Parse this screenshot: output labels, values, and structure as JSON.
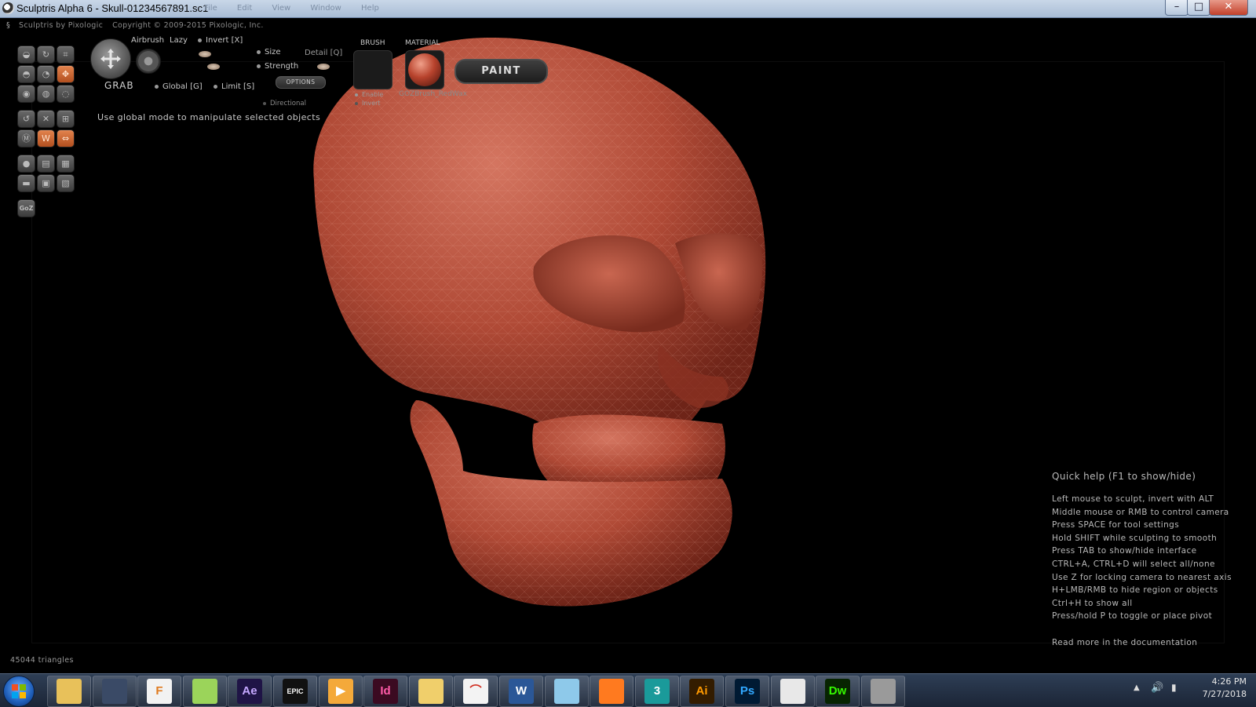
{
  "window": {
    "title": "Sculptris Alpha 6 - Skull-01234567891.sc1",
    "menu": [
      "File",
      "Edit",
      "View",
      "Window",
      "Help"
    ],
    "controls": {
      "minimize": "–",
      "maximize": "□",
      "close": "✕"
    }
  },
  "app": {
    "product": "Sculptris by Pixologic",
    "copyright": "Copyright © 2009-2015 Pixologic, Inc."
  },
  "tool_palette": {
    "goz_label": "GoZ"
  },
  "toolbar": {
    "tool_name": "GRAB",
    "airbrush_label": "Airbrush",
    "lazy_label": "Lazy",
    "invert_label": "Invert [X]",
    "size_label": "Size",
    "strength_label": "Strength",
    "detail_label": "Detail [Q]",
    "global_label": "Global [G]",
    "limit_label": "Limit [S]",
    "options_label": "OPTIONS",
    "directional_label": "Directional",
    "hint": "Use global mode to manipulate selected objects"
  },
  "brush": {
    "header": "BRUSH",
    "enable_label": "Enable",
    "invert_label": "Invert"
  },
  "material": {
    "header": "MATERIAL",
    "name": "GOZBrush_RedWax",
    "color": "#b8432d"
  },
  "paint_button": "PAINT",
  "quick_help": {
    "title": "Quick help (F1 to show/hide)",
    "lines": [
      "Left mouse to sculpt, invert with ALT",
      "Middle mouse or RMB to control camera",
      "Press SPACE for tool settings",
      "Hold SHIFT while sculpting to smooth",
      "Press TAB to show/hide interface",
      "CTRL+A, CTRL+D will select all/none",
      "Use Z for locking camera to nearest axis",
      "H+LMB/RMB to hide region or objects",
      "Ctrl+H to show all",
      "Press/hold P to toggle or place pivot"
    ],
    "more": "Read more in the documentation"
  },
  "status": {
    "triangles": "45044 triangles"
  },
  "taskbar": {
    "apps": [
      {
        "name": "Windows Explorer",
        "icon": "folder-icon",
        "text": "",
        "bg": "#e8c15a",
        "fg": "#6b4a08"
      },
      {
        "name": "3D Viewer",
        "icon": "cube-icon",
        "text": "",
        "bg": "#3a4a66",
        "fg": "#cfe3ff"
      },
      {
        "name": "Fusion",
        "icon": "f-icon",
        "text": "F",
        "bg": "#f2f2f2",
        "fg": "#e07a1f"
      },
      {
        "name": "Sticky Notes",
        "icon": "notes-icon",
        "text": "",
        "bg": "#9bd45a",
        "fg": "#333"
      },
      {
        "name": "After Effects",
        "icon": "ae-icon",
        "text": "Ae",
        "bg": "#1f1446",
        "fg": "#c5a8ff"
      },
      {
        "name": "Epic Games",
        "icon": "epic-icon",
        "text": "EPIC",
        "bg": "#111",
        "fg": "#fff"
      },
      {
        "name": "Media Player",
        "icon": "play-icon",
        "text": "▶",
        "bg": "#f4a93a",
        "fg": "#fff"
      },
      {
        "name": "InDesign",
        "icon": "id-icon",
        "text": "Id",
        "bg": "#3b0a21",
        "fg": "#ff5ba8"
      },
      {
        "name": "File Explorer",
        "icon": "folder-icon",
        "text": "",
        "bg": "#f0cf6b",
        "fg": "#6b4a08"
      },
      {
        "name": "Acrobat",
        "icon": "pdf-icon",
        "text": "⌒",
        "bg": "#f3f3f3",
        "fg": "#d02a1c"
      },
      {
        "name": "Word",
        "icon": "word-icon",
        "text": "W",
        "bg": "#2b5797",
        "fg": "#fff"
      },
      {
        "name": "Photos",
        "icon": "photos-icon",
        "text": "",
        "bg": "#8ec9ea",
        "fg": "#fff"
      },
      {
        "name": "Firefox",
        "icon": "firefox-icon",
        "text": "",
        "bg": "#ff7a1f",
        "fg": "#4a2a8a"
      },
      {
        "name": "3ds Max",
        "icon": "3dsmax-icon",
        "text": "3",
        "bg": "#1a9a9a",
        "fg": "#fff"
      },
      {
        "name": "Illustrator",
        "icon": "ai-icon",
        "text": "Ai",
        "bg": "#331c00",
        "fg": "#ff9a00"
      },
      {
        "name": "Photoshop",
        "icon": "ps-icon",
        "text": "Ps",
        "bg": "#001a33",
        "fg": "#31a8ff"
      },
      {
        "name": "Chrome",
        "icon": "chrome-icon",
        "text": "",
        "bg": "#e8e8e8",
        "fg": "#db4437"
      },
      {
        "name": "Dreamweaver",
        "icon": "dw-icon",
        "text": "Dw",
        "bg": "#072401",
        "fg": "#35fa00"
      },
      {
        "name": "Sculptris",
        "icon": "sculptris-icon",
        "text": "",
        "bg": "#9a9a9a",
        "fg": "#222"
      }
    ],
    "clock_time": "4:26 PM",
    "clock_date": "7/27/2018"
  }
}
